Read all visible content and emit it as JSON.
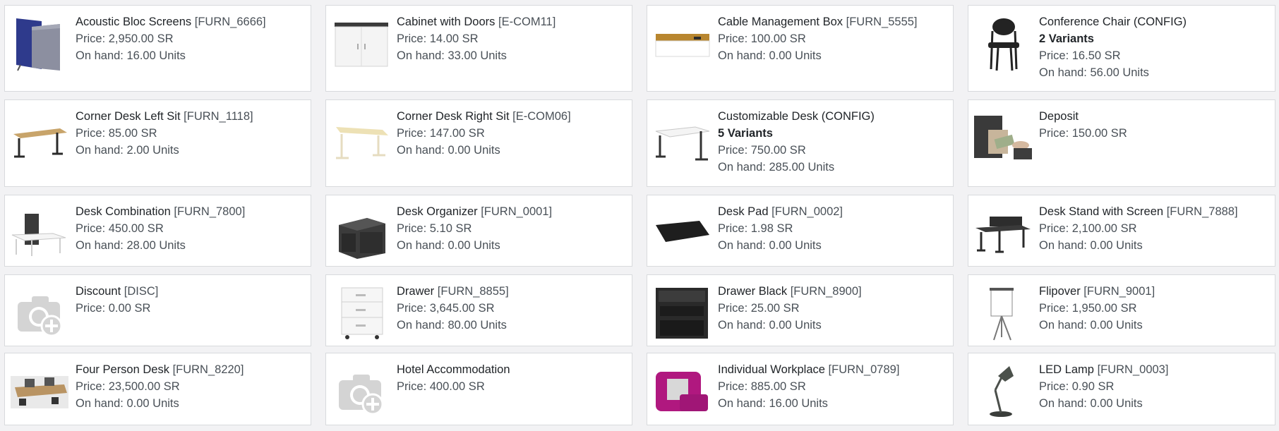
{
  "products": [
    {
      "name": "Acoustic Bloc Screens",
      "code": "[FURN_6666]",
      "variants": "",
      "price": "Price: 2,950.00 SR",
      "onhand": "On hand: 16.00 Units",
      "icon": "acoustic-screen-icon"
    },
    {
      "name": "Cabinet with Doors",
      "code": "[E-COM11]",
      "variants": "",
      "price": "Price: 14.00 SR",
      "onhand": "On hand: 33.00 Units",
      "icon": "cabinet-icon"
    },
    {
      "name": "Cable Management Box",
      "code": "[FURN_5555]",
      "variants": "",
      "price": "Price: 100.00 SR",
      "onhand": "On hand: 0.00 Units",
      "icon": "cable-box-icon"
    },
    {
      "name": "Conference Chair (CONFIG)",
      "code": "",
      "variants": "2 Variants",
      "price": "Price: 16.50 SR",
      "onhand": "On hand: 56.00 Units",
      "icon": "chair-icon"
    },
    {
      "name": "Corner Desk Left Sit",
      "code": "[FURN_1118]",
      "variants": "",
      "price": "Price: 85.00 SR",
      "onhand": "On hand: 2.00 Units",
      "icon": "desk-icon"
    },
    {
      "name": "Corner Desk Right Sit",
      "code": "[E-COM06]",
      "variants": "",
      "price": "Price: 147.00 SR",
      "onhand": "On hand: 0.00 Units",
      "icon": "desk-light-icon"
    },
    {
      "name": "Customizable Desk (CONFIG)",
      "code": "",
      "variants": "5 Variants",
      "price": "Price: 750.00 SR",
      "onhand": "On hand: 285.00 Units",
      "icon": "white-desk-icon"
    },
    {
      "name": "Deposit",
      "code": "",
      "variants": "",
      "price": "Price: 150.00 SR",
      "onhand": "",
      "icon": "money-icon"
    },
    {
      "name": "Desk Combination",
      "code": "[FURN_7800]",
      "variants": "",
      "price": "Price: 450.00 SR",
      "onhand": "On hand: 28.00 Units",
      "icon": "desk-combination-icon"
    },
    {
      "name": "Desk Organizer",
      "code": "[FURN_0001]",
      "variants": "",
      "price": "Price: 5.10 SR",
      "onhand": "On hand: 0.00 Units",
      "icon": "organizer-icon"
    },
    {
      "name": "Desk Pad",
      "code": "[FURN_0002]",
      "variants": "",
      "price": "Price: 1.98 SR",
      "onhand": "On hand: 0.00 Units",
      "icon": "desk-pad-icon"
    },
    {
      "name": "Desk Stand with Screen",
      "code": "[FURN_7888]",
      "variants": "",
      "price": "Price: 2,100.00 SR",
      "onhand": "On hand: 0.00 Units",
      "icon": "desk-stand-icon"
    },
    {
      "name": "Discount",
      "code": "[DISC]",
      "variants": "",
      "price": "Price: 0.00 SR",
      "onhand": "",
      "icon": "camera-placeholder-icon"
    },
    {
      "name": "Drawer",
      "code": "[FURN_8855]",
      "variants": "",
      "price": "Price: 3,645.00 SR",
      "onhand": "On hand: 80.00 Units",
      "icon": "drawer-icon"
    },
    {
      "name": "Drawer Black",
      "code": "[FURN_8900]",
      "variants": "",
      "price": "Price: 25.00 SR",
      "onhand": "On hand: 0.00 Units",
      "icon": "drawer-black-icon"
    },
    {
      "name": "Flipover",
      "code": "[FURN_9001]",
      "variants": "",
      "price": "Price: 1,950.00 SR",
      "onhand": "On hand: 0.00 Units",
      "icon": "flipchart-icon"
    },
    {
      "name": "Four Person Desk",
      "code": "[FURN_8220]",
      "variants": "",
      "price": "Price: 23,500.00 SR",
      "onhand": "On hand: 0.00 Units",
      "icon": "four-person-desk-icon"
    },
    {
      "name": "Hotel Accommodation",
      "code": "",
      "variants": "",
      "price": "Price: 400.00 SR",
      "onhand": "",
      "icon": "camera-placeholder-icon"
    },
    {
      "name": "Individual Workplace",
      "code": "[FURN_0789]",
      "variants": "",
      "price": "Price: 885.00 SR",
      "onhand": "On hand: 16.00 Units",
      "icon": "workplace-pod-icon"
    },
    {
      "name": "LED Lamp",
      "code": "[FURN_0003]",
      "variants": "",
      "price": "Price: 0.90 SR",
      "onhand": "On hand: 0.00 Units",
      "icon": "lamp-icon"
    }
  ]
}
